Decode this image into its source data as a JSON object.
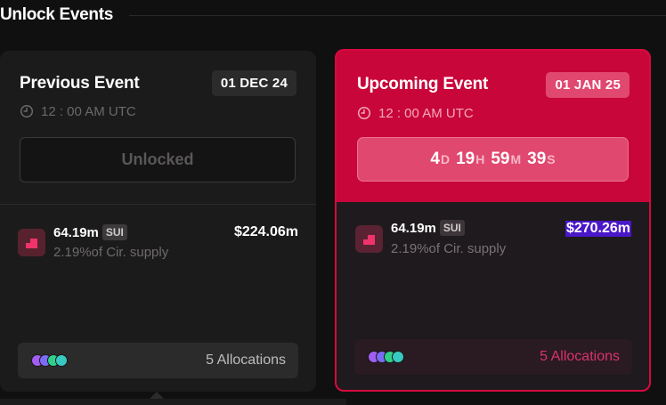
{
  "section": {
    "title": "Unlock Events"
  },
  "previous": {
    "title": "Previous Event",
    "date": "01 DEC 24",
    "time": "12 : 00 AM UTC",
    "status": "Unlocked",
    "amount": "64.19m",
    "ticker": "SUI",
    "supply": "2.19%of Cir. supply",
    "usd": "$224.06m",
    "allocations": "5 Allocations"
  },
  "upcoming": {
    "title": "Upcoming Event",
    "date": "01 JAN 25",
    "time": "12 : 00 AM UTC",
    "countdown": {
      "days": "4",
      "days_unit": "D",
      "hours": "19",
      "hours_unit": "H",
      "minutes": "59",
      "minutes_unit": "M",
      "seconds": "39",
      "seconds_unit": "S"
    },
    "amount": "64.19m",
    "ticker": "SUI",
    "supply": "2.19%of Cir. supply",
    "usd": "$270.26m",
    "allocations": "5 Allocations"
  },
  "colors": {
    "accent": "#c8063a",
    "dot_colors": [
      "#a25df2",
      "#7b6cf6",
      "#2fd08a",
      "#38c9c0"
    ]
  },
  "icons": [
    "clock-icon",
    "token-step-icon",
    "allocation-avatars"
  ]
}
